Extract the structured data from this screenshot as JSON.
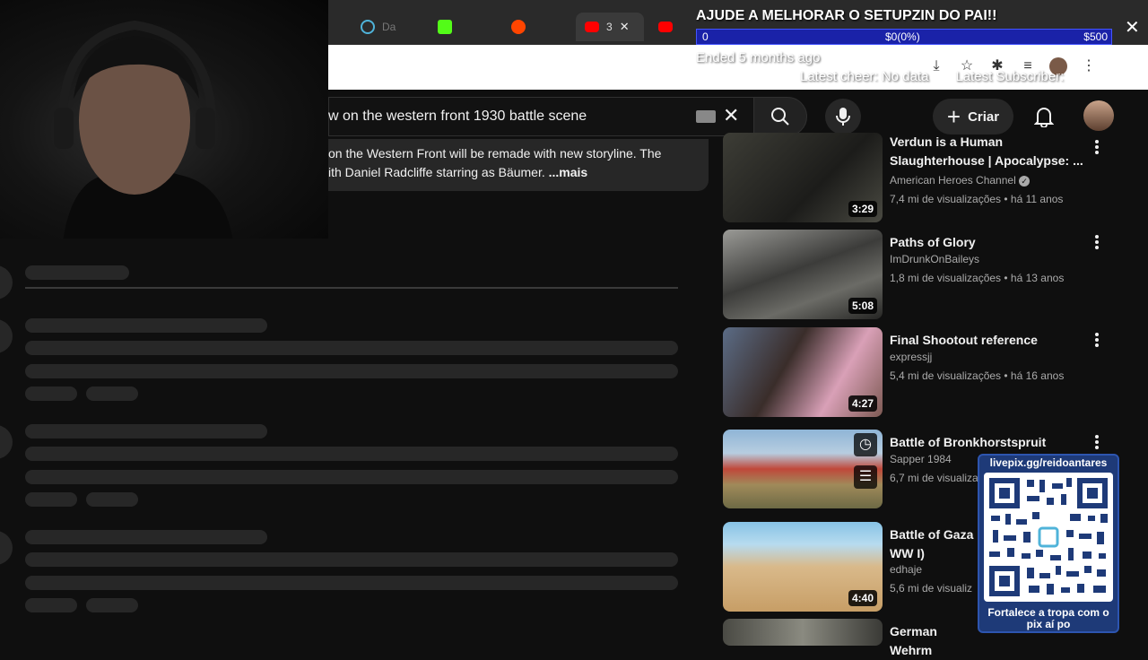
{
  "browser": {
    "tabs": [
      {
        "label": "Da",
        "icon": "circle-logo-icon",
        "color": "#4fb3d9"
      },
      {
        "label": "",
        "icon": "kick-icon",
        "color": "#53fc18"
      },
      {
        "label": "",
        "icon": "reddit-icon",
        "color": "#ff4500"
      },
      {
        "label": "3",
        "icon": "youtube-icon",
        "color": "#ff0000",
        "active": true
      },
      {
        "label": "",
        "icon": "youtube-icon",
        "color": "#ff0000"
      }
    ],
    "tab_close": "✕"
  },
  "youtube": {
    "search": {
      "query": "w on the western front 1930 battle scene"
    },
    "create_label": "Criar",
    "description": {
      "line1": "on the Western Front will be remade with new storyline.  The",
      "line2": "ith Daniel Radcliffe starring as Bäumer.",
      "more": "...mais"
    },
    "related": [
      {
        "title": "Verdun is a Human Slaughterhouse | Apocalypse: ...",
        "channel": "American Heroes Channel",
        "verified": true,
        "meta": "7,4 mi de visualizações • há 11 anos",
        "duration": "3:29"
      },
      {
        "title": "Paths of Glory",
        "channel": "ImDrunkOnBaileys",
        "meta": "1,8 mi de visualizações • há 13 anos",
        "duration": "5:08"
      },
      {
        "title": "Final Shootout reference",
        "channel": "expressjj",
        "meta": "5,4 mi de visualizações • há 16 anos",
        "duration": "4:27"
      },
      {
        "title": "Battle of Bronkhorstspruit",
        "channel": "Sapper 1984",
        "meta": "6,7 mi de visualizaç",
        "duration": ""
      },
      {
        "title": "Battle of Gaza WW I)",
        "channel": "edhaje",
        "meta": "5,6 mi de visualiz",
        "duration": "4:40"
      },
      {
        "title": "German Wehrm",
        "channel": "",
        "meta": "",
        "duration": ""
      }
    ]
  },
  "overlay": {
    "goal_title": "AJUDE A MELHORAR O SETUPZIN DO PAI!!",
    "goal_min": "0",
    "goal_progress": "$0(0%)",
    "goal_max": "$500",
    "ended": "Ended 5 months ago",
    "latest_cheer": "Latest cheer: No data",
    "latest_sub": "Latest Subscriber:",
    "qr_url": "livepix.gg/reidoantares",
    "qr_footer": "Fortalece a tropa com o pix aí po"
  }
}
